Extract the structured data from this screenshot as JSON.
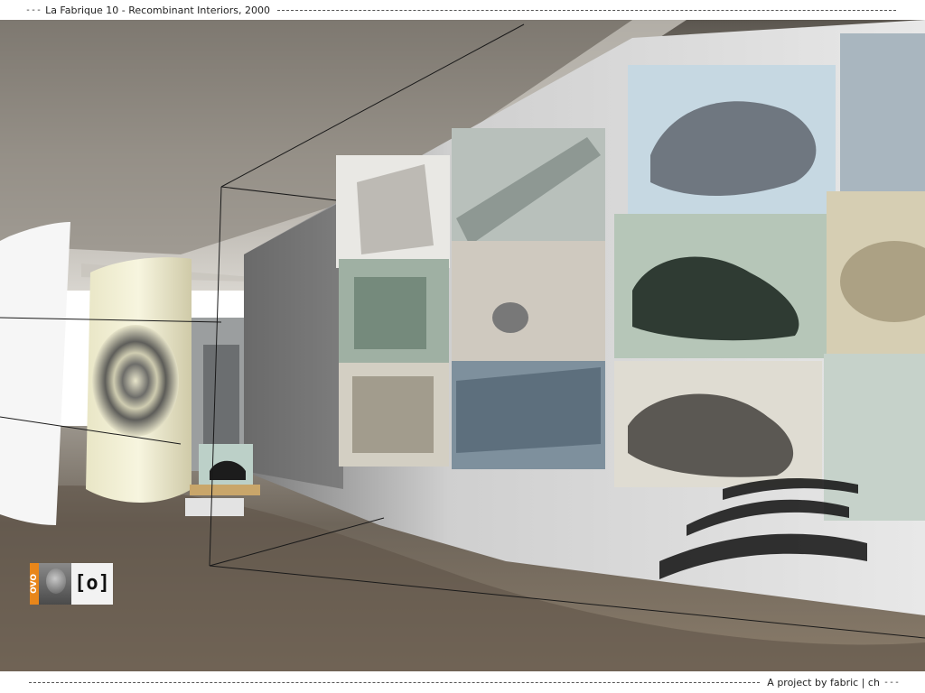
{
  "header": {
    "dash_left": "---",
    "title": "La Fabrique 10 - Recombinant Interiors, 2000"
  },
  "footer": {
    "dash_right": "---",
    "credit": "A project by fabric | ch"
  },
  "overlay": {
    "logo_text": "OVO",
    "mark_text": "[o]"
  },
  "icons": {
    "avatar": "avatar-icon",
    "mark": "bracket-o-icon"
  },
  "colors": {
    "accent": "#e8861a",
    "background": "#ffffff"
  }
}
